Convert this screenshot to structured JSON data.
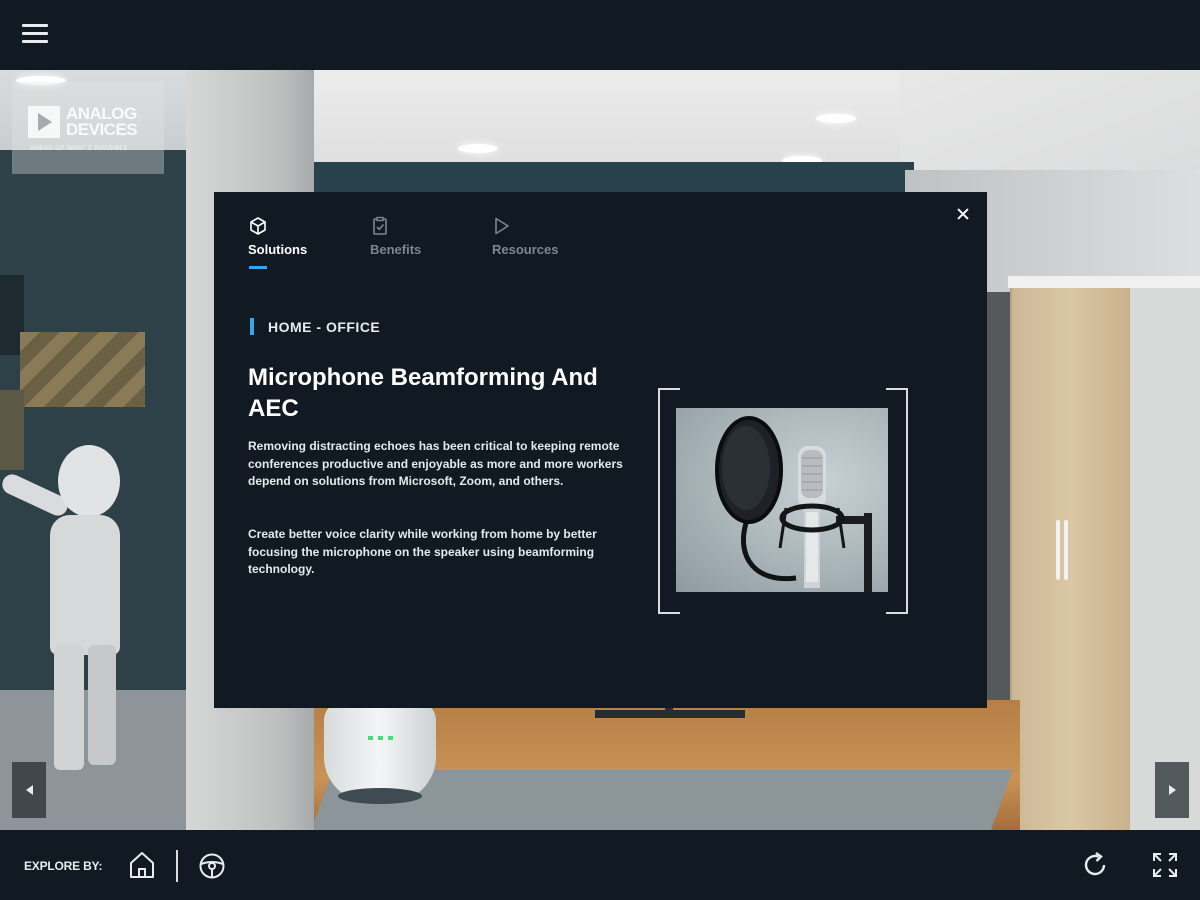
{
  "brand": {
    "name_line1": "ANALOG",
    "name_line2": "DEVICES",
    "tagline": "AHEAD OF WHAT'S POSSIBLE"
  },
  "modal": {
    "tabs": [
      {
        "label": "Solutions",
        "icon": "cube-icon",
        "active": true
      },
      {
        "label": "Benefits",
        "icon": "clipboard-check-icon",
        "active": false
      },
      {
        "label": "Resources",
        "icon": "play-icon",
        "active": false
      }
    ],
    "category": "HOME - OFFICE",
    "title": "Microphone Beamforming And AEC",
    "paragraph1": "Removing distracting echoes has been critical to keeping remote conferences productive and enjoyable as more and more workers depend on solutions from Microsoft, Zoom, and others.",
    "paragraph2": "Create better voice clarity while working from home by better focusing the microphone on the speaker using beamforming technology.",
    "image": "studio-microphone-with-pop-filter"
  },
  "bottombar": {
    "explore_label": "EXPLORE BY:",
    "icons": [
      "home-icon",
      "steering-wheel-icon",
      "refresh-icon",
      "fullscreen-icon"
    ]
  },
  "colors": {
    "panel": "#111923",
    "accent": "#3aa4e8",
    "inactive_tab": "#7c8691"
  }
}
